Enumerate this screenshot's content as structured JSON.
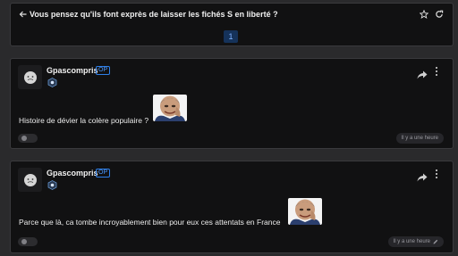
{
  "header": {
    "title": "Vous pensez qu'ils font exprès de laisser les fichés S en liberté ?",
    "current_page": "1",
    "icons": [
      "back-arrow-icon",
      "star-icon",
      "refresh-icon"
    ]
  },
  "posts": [
    {
      "author": "Gpascompris",
      "badge": "OP",
      "text": "Histoire de dévier la colère populaire ?",
      "timestamp": "Il y a une heure",
      "edited": false,
      "icons": [
        "avatar-icon",
        "rank-icon",
        "share-icon",
        "more-icon",
        "sticker-image"
      ]
    },
    {
      "author": "Gpascompris",
      "badge": "OP",
      "text": "Parce que là, ca tombe incroyablement bien pour eux ces attentats en France",
      "timestamp": "Il y a une heure",
      "edited": true,
      "icons": [
        "avatar-icon",
        "rank-icon",
        "share-icon",
        "more-icon",
        "sticker-image",
        "pencil-icon"
      ]
    }
  ],
  "colors": {
    "background": "#2a2a2c",
    "card": "#111112",
    "accent_blue": "#2e7fe8",
    "page_button_bg": "#15325a"
  }
}
